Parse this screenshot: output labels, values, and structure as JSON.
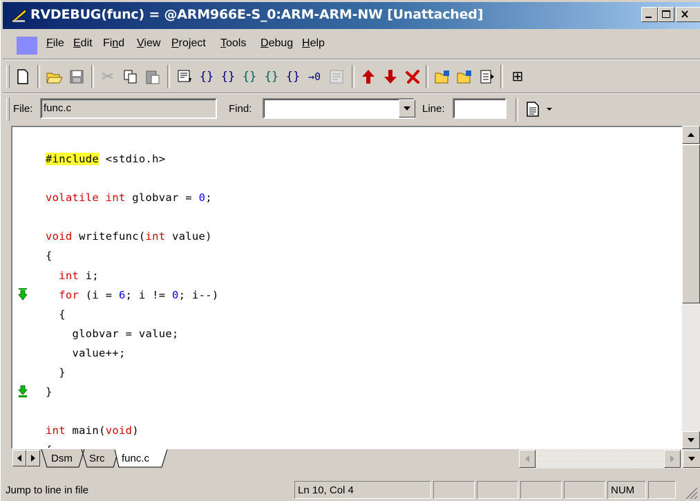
{
  "window": {
    "title": "RVDEBUG(func) = @ARM966E-S_0:ARM-ARM-NW [Unattached]"
  },
  "menu": {
    "items": [
      {
        "label": "File",
        "mnemonic": "F",
        "rest": "ile"
      },
      {
        "label": "Edit",
        "mnemonic": "E",
        "rest": "dit"
      },
      {
        "label": "Find",
        "pre": "Fi",
        "mnemonic": "n",
        "rest": "d"
      },
      {
        "label": "View",
        "mnemonic": "V",
        "rest": "iew"
      },
      {
        "label": "Project",
        "mnemonic": "P",
        "rest": "roject"
      },
      {
        "label": "Tools",
        "mnemonic": "T",
        "rest": "ools"
      },
      {
        "label": "Debug",
        "mnemonic": "D",
        "rest": "ebug"
      },
      {
        "label": "Help",
        "mnemonic": "H",
        "rest": "elp"
      }
    ]
  },
  "findbar": {
    "file_label": "File:",
    "file_value": "func.c",
    "find_label": "Find:",
    "find_value": "",
    "line_label": "Line:",
    "line_value": ""
  },
  "code": {
    "lines": [
      "#include <stdio.h>",
      "volatile int globvar = 0;",
      "void writefunc(int value)",
      "{",
      "  int i;",
      "  for (i = 6; i != 0; i--)",
      "  {",
      "    globvar = value;",
      "    value++;",
      "  }",
      "}",
      "int main(void)"
    ]
  },
  "tabs": [
    "Dsm",
    "Src",
    "func.c"
  ],
  "status": {
    "message": "Jump to line in file",
    "position": "Ln 10, Col 4",
    "num": "NUM"
  },
  "colors": {
    "keyword": "#d00000",
    "number": "#0000ff",
    "highlight": "#ffff33",
    "breakpoint_arrow": "#00a000"
  }
}
